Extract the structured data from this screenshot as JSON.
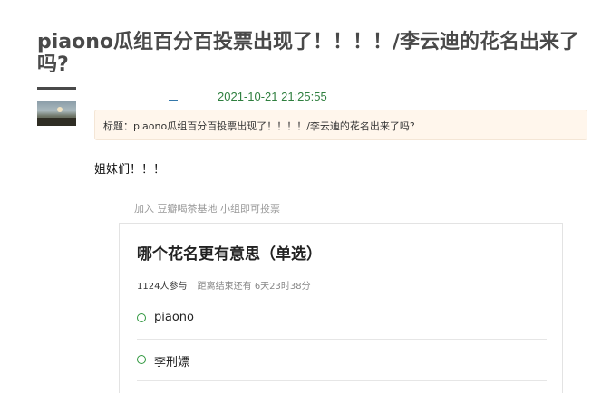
{
  "post": {
    "title": "piaono瓜组百分百投票出现了！！！！/李云迪的花名出来了吗?",
    "author_name": "_",
    "timestamp": "2021-10-21 21:25:55",
    "subject_line": "标题：piaono瓜组百分百投票出现了！！！！/李云迪的花名出来了吗?",
    "body": "姐妹们！！！"
  },
  "group_note": "加入 豆瓣喝茶基地 小组即可投票",
  "poll": {
    "title": "哪个花名更有意思（单选）",
    "participants": "1124人参与",
    "remaining": "距离结束还有 6天23时38分",
    "options": [
      {
        "label": "piaono"
      },
      {
        "label": "李刑嫖"
      }
    ]
  },
  "colors": {
    "title": "#494949",
    "timestamp": "#2f7f3f",
    "subject_bg": "#fff6ec",
    "radio": "#2e963d"
  },
  "icons": {
    "option_marker": "radio-circle-icon"
  }
}
